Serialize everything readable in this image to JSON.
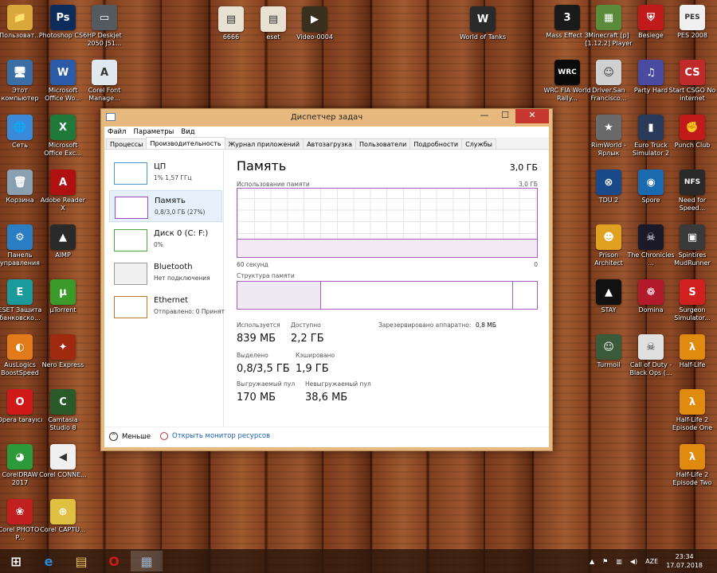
{
  "desktop": {
    "icons_left": [
      {
        "label": "Пользоват...",
        "color": "#d9a73a",
        "glyph": "📁"
      },
      {
        "label": "Этот компьютер",
        "color": "#3a6ea5",
        "glyph": "🖥"
      },
      {
        "label": "Сеть",
        "color": "#3a8ad8",
        "glyph": "🌐"
      },
      {
        "label": "Корзина",
        "color": "#8aa0b0",
        "glyph": "🗑"
      },
      {
        "label": "Панель управления",
        "color": "#2a7fc4",
        "glyph": "⚙"
      },
      {
        "label": "ESET Защита банковско...",
        "color": "#1a9a9a",
        "glyph": "E"
      },
      {
        "label": "AusLogics BoostSpeed",
        "color": "#e07a1a",
        "glyph": "◐"
      },
      {
        "label": "Opera tarayıcı",
        "color": "#d01a1a",
        "glyph": "O"
      },
      {
        "label": "CorelDRAW 2017",
        "color": "#2c9a3a",
        "glyph": "◕"
      },
      {
        "label": "Corel PHOTO-P...",
        "color": "#c02020",
        "glyph": "❀"
      }
    ],
    "icons_col2": [
      {
        "label": "Photoshop CS6",
        "color": "#0c2c5c",
        "glyph": "Ps"
      },
      {
        "label": "Microsoft Office Wo...",
        "color": "#2a5aa8",
        "glyph": "W"
      },
      {
        "label": "Microsoft Office Exc...",
        "color": "#1f7a3a",
        "glyph": "X"
      },
      {
        "label": "Adobe Reader X",
        "color": "#b01010",
        "glyph": "A"
      },
      {
        "label": "AIMP",
        "color": "#2a2a2a",
        "glyph": "▲"
      },
      {
        "label": "µTorrent",
        "color": "#3a9a2a",
        "glyph": "µ"
      },
      {
        "label": "Nero Express",
        "color": "#a02a10",
        "glyph": "✦"
      },
      {
        "label": "Camtasia Studio 8",
        "color": "#2a5a2a",
        "glyph": "C"
      },
      {
        "label": "Corel CONNE...",
        "color": "#f0f0f0",
        "glyph": "◀"
      },
      {
        "label": "Corel CAPTU...",
        "color": "#e0c040",
        "glyph": "⊕"
      }
    ],
    "icons_col3": [
      {
        "label": "HP Deskjet 2050 J51...",
        "color": "#555a60",
        "glyph": "▭"
      },
      {
        "label": "Corel Font Manage...",
        "color": "#dfe7ef",
        "glyph": "A"
      }
    ],
    "icons_top": [
      {
        "label": "6666",
        "color": "#e8e0d0",
        "glyph": "▤"
      },
      {
        "label": "eset",
        "color": "#e8e0d0",
        "glyph": "▤"
      },
      {
        "label": "Video-0004",
        "color": "#3a3020",
        "glyph": "▶"
      },
      {
        "label": "World of Tanks",
        "color": "#2a2a2a",
        "glyph": "W"
      }
    ],
    "icons_right1": [
      {
        "label": "Mass Effect 3",
        "color": "#1a1a1a",
        "glyph": "3"
      },
      {
        "label": "WRC FIA World Rally...",
        "color": "#0a0a0a",
        "glyph": "WRC"
      }
    ],
    "icons_right2": [
      {
        "label": "Minecraft [p] [1.12.2] Player",
        "color": "#5a8a3a",
        "glyph": "▦"
      },
      {
        "label": "Driver.San Francisco...",
        "color": "#d0d0d0",
        "glyph": "☺"
      },
      {
        "label": "RimWorld - Ярлык",
        "color": "#6a6a6a",
        "glyph": "★"
      },
      {
        "label": "TDU 2",
        "color": "#1a4a8a",
        "glyph": "⊗"
      },
      {
        "label": "Prison Architect",
        "color": "#e0a020",
        "glyph": "☻"
      },
      {
        "label": "STAY",
        "color": "#111",
        "glyph": "▲"
      },
      {
        "label": "Turmoil",
        "color": "#3a5a3a",
        "glyph": "☺"
      }
    ],
    "icons_right3": [
      {
        "label": "Besiege",
        "color": "#c01a1a",
        "glyph": "⛨"
      },
      {
        "label": "Party Hard",
        "color": "#4a4aa0",
        "glyph": "♫"
      },
      {
        "label": "Euro Truck Simulator 2",
        "color": "#2a3a5a",
        "glyph": "▮"
      },
      {
        "label": "Spore",
        "color": "#1a6ab0",
        "glyph": "◉"
      },
      {
        "label": "The Chronicles ...",
        "color": "#1a1a2a",
        "glyph": "☠"
      },
      {
        "label": "Domina",
        "color": "#b01a2a",
        "glyph": "❁"
      },
      {
        "label": "Call of Duty - Black Ops (...",
        "color": "#e0e0e0",
        "glyph": "☠"
      }
    ],
    "icons_right4": [
      {
        "label": "PES 2008",
        "color": "#f0f0f0",
        "glyph": "PES"
      },
      {
        "label": "Start CSGO No internet",
        "color": "#c02a2a",
        "glyph": "CS"
      },
      {
        "label": "Punch Club",
        "color": "#c01a1a",
        "glyph": "✊"
      },
      {
        "label": "Need for Speed...",
        "color": "#2a2a2a",
        "glyph": "NFS"
      },
      {
        "label": "Spintires MudRunner",
        "color": "#3a3a3a",
        "glyph": "▣"
      },
      {
        "label": "Surgeon Simulator...",
        "color": "#d02020",
        "glyph": "S"
      },
      {
        "label": "Half-Life",
        "color": "#e08a10",
        "glyph": "λ"
      },
      {
        "label": "Half-Life 2 Episode One",
        "color": "#e08a10",
        "glyph": "λ"
      },
      {
        "label": "Half-Life 2 Episode Two",
        "color": "#e08a10",
        "glyph": "λ"
      }
    ]
  },
  "window": {
    "title": "Диспетчер задач",
    "controls": {
      "minimize": "—",
      "maximize": "☐",
      "close": "✕"
    },
    "menu": [
      "Файл",
      "Параметры",
      "Вид"
    ],
    "tabs": [
      "Процессы",
      "Производительность",
      "Журнал приложений",
      "Автозагрузка",
      "Пользователи",
      "Подробности",
      "Службы"
    ],
    "active_tab": 1,
    "resources": [
      {
        "name": "ЦП",
        "sub": "1% 1,57 ГГц",
        "color": "#4a9ad8"
      },
      {
        "name": "Память",
        "sub": "0,8/3,0 ГБ (27%)",
        "color": "#9a4ab8"
      },
      {
        "name": "Диск 0 (C: F:)",
        "sub": "0%",
        "color": "#4aaa3a"
      },
      {
        "name": "Bluetooth",
        "sub": "Нет подключения",
        "color": "#999999"
      },
      {
        "name": "Ethernet",
        "sub": "Отправлено: 0 Принят",
        "color": "#c07a30"
      }
    ],
    "selected_resource": 1,
    "memory": {
      "title": "Память",
      "total": "3,0 ГБ",
      "usage_label": "Использование памяти",
      "usage_max": "3,0 ГБ",
      "time_left": "60 секунд",
      "time_right": "0",
      "usage_fraction": 0.27,
      "structure_label": "Структура памяти",
      "structure": {
        "in_use": 0.28,
        "modified": 0.0,
        "standby": 0.64,
        "free": 0.08
      },
      "stats": {
        "in_use_label": "Используется",
        "in_use": "839 МБ",
        "available_label": "Доступно",
        "available": "2,2 ГБ",
        "reserved_label": "Зарезервировано аппаратно:",
        "reserved": "0,8 МБ",
        "committed_label": "Выделено",
        "committed": "0,8/3,5 ГБ",
        "cached_label": "Кэшировано",
        "cached": "1,9 ГБ",
        "paged_label": "Выгружаемый пул",
        "paged": "170 МБ",
        "nonpaged_label": "Невыгружаемый пул",
        "nonpaged": "38,6 МБ"
      }
    },
    "footer": {
      "less": "Меньше",
      "monitor": "Открыть монитор ресурсов"
    }
  },
  "taskbar": {
    "apps": [
      {
        "name": "start",
        "glyph": "⊞"
      },
      {
        "name": "ie",
        "glyph": "e"
      },
      {
        "name": "explorer",
        "glyph": "▤"
      },
      {
        "name": "opera",
        "glyph": "O"
      },
      {
        "name": "taskmgr",
        "glyph": "▦"
      }
    ],
    "lang": "AZE",
    "time": "23:34",
    "date": "17.07.2018"
  }
}
